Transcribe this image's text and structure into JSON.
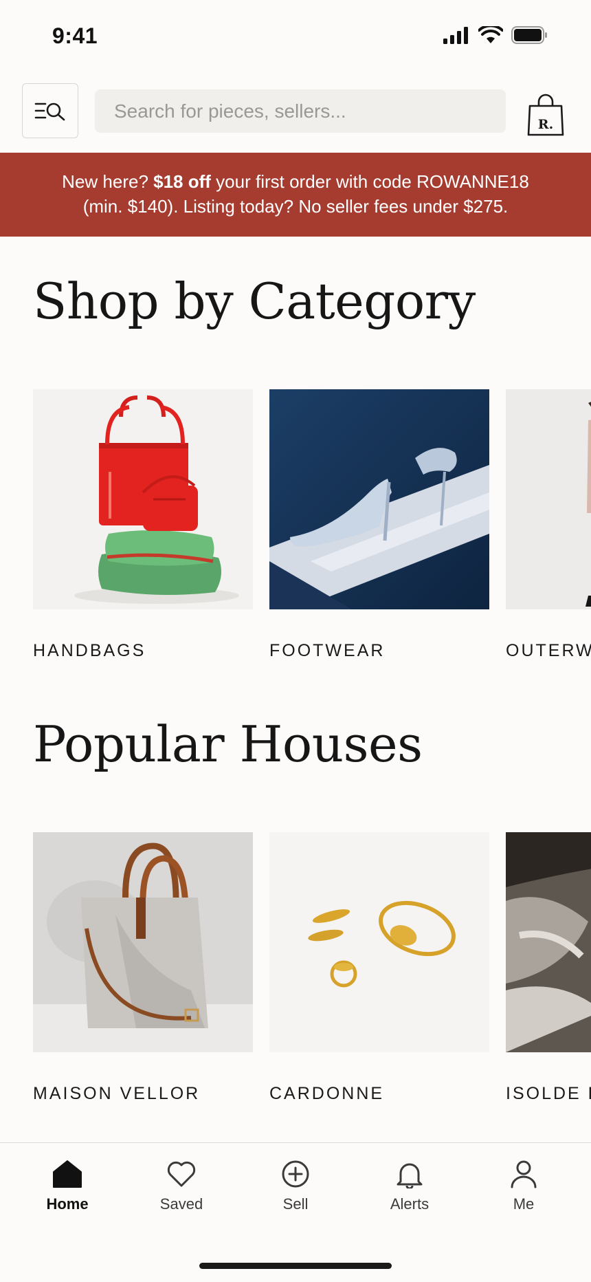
{
  "status_bar": {
    "time": "9:41"
  },
  "header": {
    "menu_icon": "menu-search-icon",
    "search_placeholder": "Search for pieces, sellers...",
    "bag_icon": "shopping-bag-icon",
    "bag_monogram": "R."
  },
  "promo": {
    "text_1": "New here? ",
    "text_bold": "$18 off",
    "text_2": " your first order with code ROWANNE18",
    "text_3": "(min. $140). Listing today? No seller fees under $275."
  },
  "categories": {
    "title": "Shop by Category",
    "items": [
      {
        "label": "HANDBAGS"
      },
      {
        "label": "FOOTWEAR"
      },
      {
        "label": "OUTERW"
      }
    ]
  },
  "houses": {
    "title": "Popular Houses",
    "items": [
      {
        "label": "MAISON VELLOR"
      },
      {
        "label": "CARDONNE"
      },
      {
        "label": "ISOLDE P"
      }
    ]
  },
  "tabbar": {
    "tabs": [
      {
        "label": "Home",
        "icon": "home-icon",
        "active": true
      },
      {
        "label": "Saved",
        "icon": "heart-icon"
      },
      {
        "label": "Sell",
        "icon": "plus-circle-icon"
      },
      {
        "label": "Alerts",
        "icon": "bell-icon"
      },
      {
        "label": "Me",
        "icon": "user-icon"
      }
    ]
  },
  "colors": {
    "promo_bg": "#a63c30",
    "background": "#fcfbfa",
    "search_bg": "#f1efec"
  }
}
